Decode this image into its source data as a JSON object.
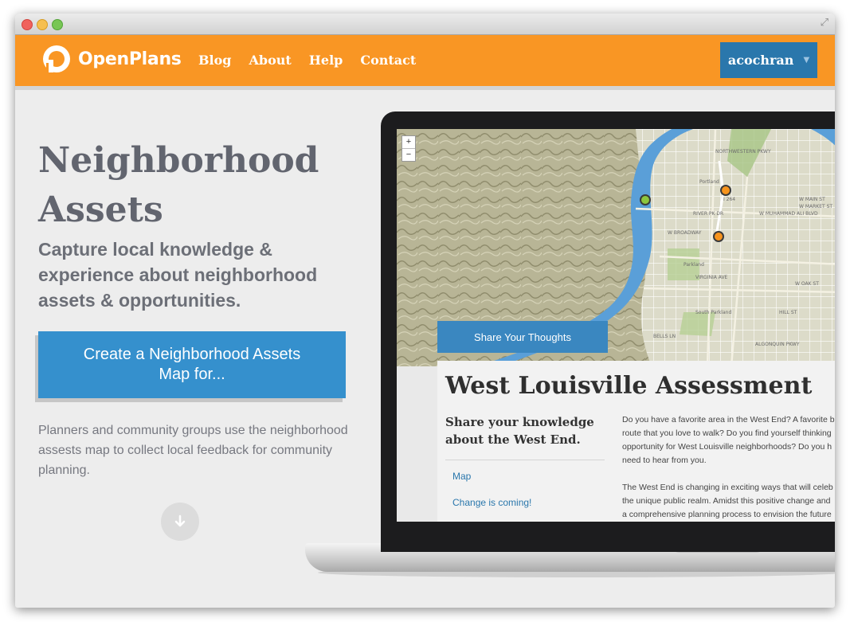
{
  "brand": {
    "name": "OpenPlans"
  },
  "nav": {
    "links": [
      {
        "label": "Blog"
      },
      {
        "label": "About"
      },
      {
        "label": "Help"
      },
      {
        "label": "Contact"
      }
    ]
  },
  "user": {
    "username": "acochran"
  },
  "hero": {
    "title": "Neighborhood Assets",
    "subtitle": "Capture local knowledge & experience about neighborhood assets & opportunities.",
    "cta_label": "Create a Neighborhood Assets Map for...",
    "description": "Planners and community groups use the neighborhood assests map to collect local feedback for community planning."
  },
  "preview": {
    "zoom_in": "+",
    "zoom_out": "−",
    "share_button": "Share Your Thoughts",
    "title": "West Louisville Assessment",
    "subtitle": "Share your knowledge about the West End.",
    "links": [
      {
        "label": "Map"
      },
      {
        "label": "Change is coming!"
      }
    ],
    "paragraph1_lines": [
      "Do you have a favorite area in the West End? A favorite b",
      "route that you love to walk? Do you find yourself thinking",
      "opportunity for West Louisville neighborhoods? Do you h",
      "need to hear from you."
    ],
    "paragraph2_lines": [
      "The West End is changing in exciting ways that will celeb",
      "the unique public realm. Amidst this positive change and",
      "a comprehensive planning process to envision the future"
    ],
    "map_labels": {
      "portland": "Portland",
      "parkland": "Parkland",
      "south_parkland": "South Parkland",
      "west_broadway": "W BROADWAY",
      "river_pk": "RIVER PK DR",
      "virginia": "VIRGINIA AVE",
      "muhammad_ali": "W MUHAMMAD ALI BLVD",
      "market": "W MARKET ST",
      "main": "W MAIN ST",
      "oak": "W OAK ST",
      "hill": "HILL ST",
      "algonquin": "ALGONQUIN PKWY",
      "northwestern": "NORTHWESTERN PKWY",
      "bells": "BELLS LN",
      "i264": "I 264"
    },
    "marker_colors": {
      "green": "#8cc63f",
      "orange": "#f7941d"
    }
  },
  "colors": {
    "navbar": "#f99624",
    "user_button": "#2a77ac",
    "cta": "#3590cd",
    "heading": "#62656f"
  }
}
